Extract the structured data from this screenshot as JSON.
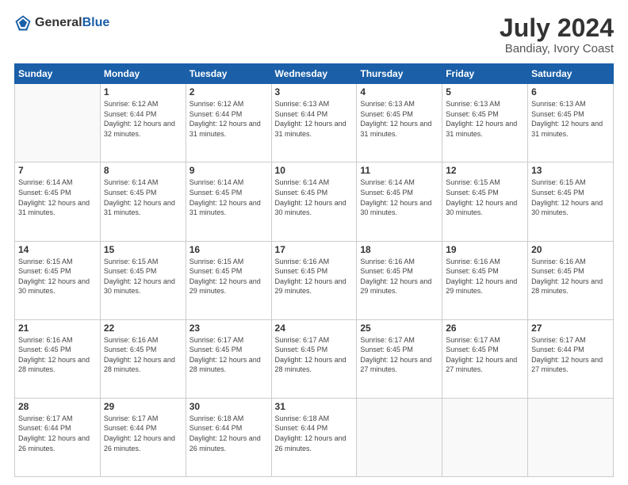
{
  "header": {
    "logo_general": "General",
    "logo_blue": "Blue",
    "month_year": "July 2024",
    "location": "Bandiay, Ivory Coast"
  },
  "days_of_week": [
    "Sunday",
    "Monday",
    "Tuesday",
    "Wednesday",
    "Thursday",
    "Friday",
    "Saturday"
  ],
  "weeks": [
    [
      {
        "day": "",
        "sunrise": "",
        "sunset": "",
        "daylight": ""
      },
      {
        "day": "1",
        "sunrise": "Sunrise: 6:12 AM",
        "sunset": "Sunset: 6:44 PM",
        "daylight": "Daylight: 12 hours and 32 minutes."
      },
      {
        "day": "2",
        "sunrise": "Sunrise: 6:12 AM",
        "sunset": "Sunset: 6:44 PM",
        "daylight": "Daylight: 12 hours and 31 minutes."
      },
      {
        "day": "3",
        "sunrise": "Sunrise: 6:13 AM",
        "sunset": "Sunset: 6:44 PM",
        "daylight": "Daylight: 12 hours and 31 minutes."
      },
      {
        "day": "4",
        "sunrise": "Sunrise: 6:13 AM",
        "sunset": "Sunset: 6:45 PM",
        "daylight": "Daylight: 12 hours and 31 minutes."
      },
      {
        "day": "5",
        "sunrise": "Sunrise: 6:13 AM",
        "sunset": "Sunset: 6:45 PM",
        "daylight": "Daylight: 12 hours and 31 minutes."
      },
      {
        "day": "6",
        "sunrise": "Sunrise: 6:13 AM",
        "sunset": "Sunset: 6:45 PM",
        "daylight": "Daylight: 12 hours and 31 minutes."
      }
    ],
    [
      {
        "day": "7",
        "sunrise": "Sunrise: 6:14 AM",
        "sunset": "Sunset: 6:45 PM",
        "daylight": "Daylight: 12 hours and 31 minutes."
      },
      {
        "day": "8",
        "sunrise": "Sunrise: 6:14 AM",
        "sunset": "Sunset: 6:45 PM",
        "daylight": "Daylight: 12 hours and 31 minutes."
      },
      {
        "day": "9",
        "sunrise": "Sunrise: 6:14 AM",
        "sunset": "Sunset: 6:45 PM",
        "daylight": "Daylight: 12 hours and 31 minutes."
      },
      {
        "day": "10",
        "sunrise": "Sunrise: 6:14 AM",
        "sunset": "Sunset: 6:45 PM",
        "daylight": "Daylight: 12 hours and 30 minutes."
      },
      {
        "day": "11",
        "sunrise": "Sunrise: 6:14 AM",
        "sunset": "Sunset: 6:45 PM",
        "daylight": "Daylight: 12 hours and 30 minutes."
      },
      {
        "day": "12",
        "sunrise": "Sunrise: 6:15 AM",
        "sunset": "Sunset: 6:45 PM",
        "daylight": "Daylight: 12 hours and 30 minutes."
      },
      {
        "day": "13",
        "sunrise": "Sunrise: 6:15 AM",
        "sunset": "Sunset: 6:45 PM",
        "daylight": "Daylight: 12 hours and 30 minutes."
      }
    ],
    [
      {
        "day": "14",
        "sunrise": "Sunrise: 6:15 AM",
        "sunset": "Sunset: 6:45 PM",
        "daylight": "Daylight: 12 hours and 30 minutes."
      },
      {
        "day": "15",
        "sunrise": "Sunrise: 6:15 AM",
        "sunset": "Sunset: 6:45 PM",
        "daylight": "Daylight: 12 hours and 30 minutes."
      },
      {
        "day": "16",
        "sunrise": "Sunrise: 6:15 AM",
        "sunset": "Sunset: 6:45 PM",
        "daylight": "Daylight: 12 hours and 29 minutes."
      },
      {
        "day": "17",
        "sunrise": "Sunrise: 6:16 AM",
        "sunset": "Sunset: 6:45 PM",
        "daylight": "Daylight: 12 hours and 29 minutes."
      },
      {
        "day": "18",
        "sunrise": "Sunrise: 6:16 AM",
        "sunset": "Sunset: 6:45 PM",
        "daylight": "Daylight: 12 hours and 29 minutes."
      },
      {
        "day": "19",
        "sunrise": "Sunrise: 6:16 AM",
        "sunset": "Sunset: 6:45 PM",
        "daylight": "Daylight: 12 hours and 29 minutes."
      },
      {
        "day": "20",
        "sunrise": "Sunrise: 6:16 AM",
        "sunset": "Sunset: 6:45 PM",
        "daylight": "Daylight: 12 hours and 28 minutes."
      }
    ],
    [
      {
        "day": "21",
        "sunrise": "Sunrise: 6:16 AM",
        "sunset": "Sunset: 6:45 PM",
        "daylight": "Daylight: 12 hours and 28 minutes."
      },
      {
        "day": "22",
        "sunrise": "Sunrise: 6:16 AM",
        "sunset": "Sunset: 6:45 PM",
        "daylight": "Daylight: 12 hours and 28 minutes."
      },
      {
        "day": "23",
        "sunrise": "Sunrise: 6:17 AM",
        "sunset": "Sunset: 6:45 PM",
        "daylight": "Daylight: 12 hours and 28 minutes."
      },
      {
        "day": "24",
        "sunrise": "Sunrise: 6:17 AM",
        "sunset": "Sunset: 6:45 PM",
        "daylight": "Daylight: 12 hours and 28 minutes."
      },
      {
        "day": "25",
        "sunrise": "Sunrise: 6:17 AM",
        "sunset": "Sunset: 6:45 PM",
        "daylight": "Daylight: 12 hours and 27 minutes."
      },
      {
        "day": "26",
        "sunrise": "Sunrise: 6:17 AM",
        "sunset": "Sunset: 6:45 PM",
        "daylight": "Daylight: 12 hours and 27 minutes."
      },
      {
        "day": "27",
        "sunrise": "Sunrise: 6:17 AM",
        "sunset": "Sunset: 6:44 PM",
        "daylight": "Daylight: 12 hours and 27 minutes."
      }
    ],
    [
      {
        "day": "28",
        "sunrise": "Sunrise: 6:17 AM",
        "sunset": "Sunset: 6:44 PM",
        "daylight": "Daylight: 12 hours and 26 minutes."
      },
      {
        "day": "29",
        "sunrise": "Sunrise: 6:17 AM",
        "sunset": "Sunset: 6:44 PM",
        "daylight": "Daylight: 12 hours and 26 minutes."
      },
      {
        "day": "30",
        "sunrise": "Sunrise: 6:18 AM",
        "sunset": "Sunset: 6:44 PM",
        "daylight": "Daylight: 12 hours and 26 minutes."
      },
      {
        "day": "31",
        "sunrise": "Sunrise: 6:18 AM",
        "sunset": "Sunset: 6:44 PM",
        "daylight": "Daylight: 12 hours and 26 minutes."
      },
      {
        "day": "",
        "sunrise": "",
        "sunset": "",
        "daylight": ""
      },
      {
        "day": "",
        "sunrise": "",
        "sunset": "",
        "daylight": ""
      },
      {
        "day": "",
        "sunrise": "",
        "sunset": "",
        "daylight": ""
      }
    ]
  ]
}
